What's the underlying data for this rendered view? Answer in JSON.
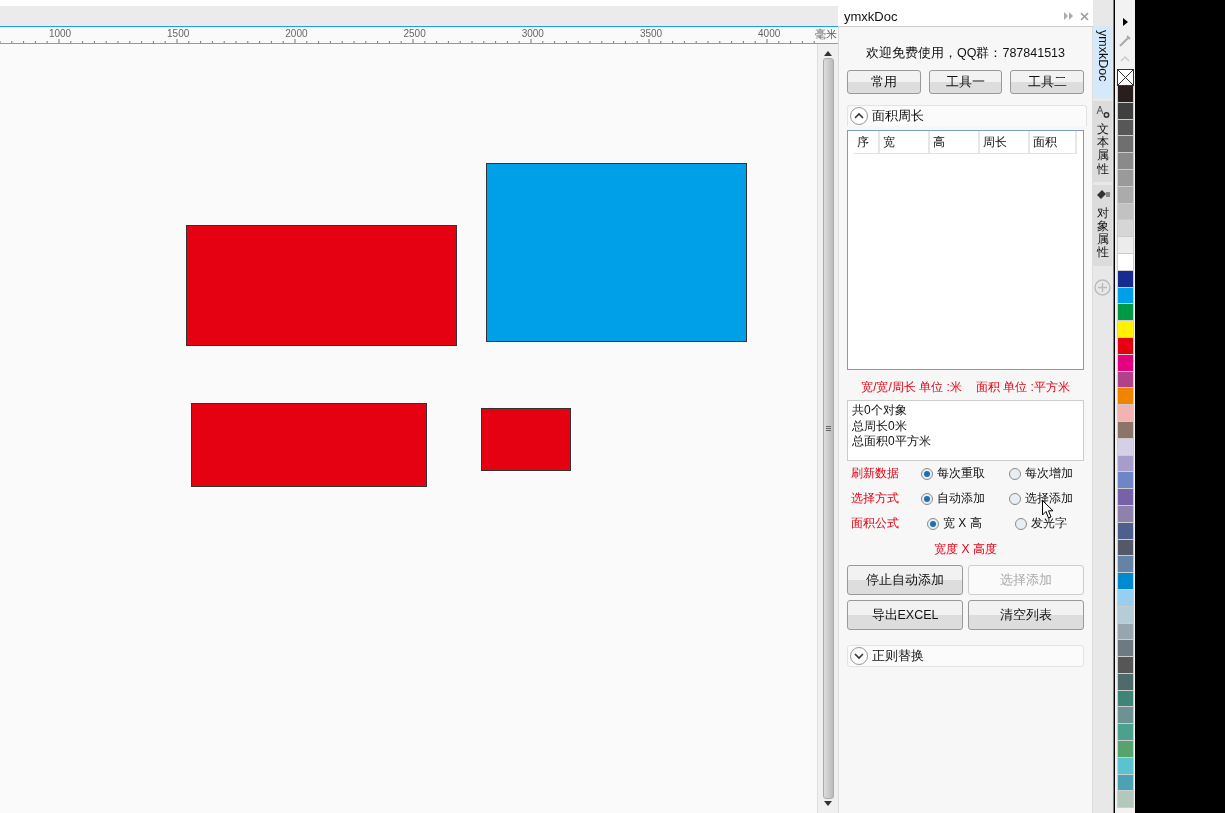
{
  "ruler": {
    "labels": [
      "1000",
      "1500",
      "2000",
      "2500",
      "3000",
      "3500",
      "4000"
    ],
    "unit": "毫米"
  },
  "canvas": {
    "shapes": [
      {
        "kind": "rect",
        "color": "#e50012"
      },
      {
        "kind": "rect",
        "color": "#00a0e9"
      },
      {
        "kind": "rect",
        "color": "#e50012"
      },
      {
        "kind": "rect",
        "color": "#e50012"
      }
    ]
  },
  "panel": {
    "title": "ymxkDoc",
    "welcome": "欢迎免费使用，QQ群：787841513",
    "tabs": [
      {
        "label": "常用",
        "selected": false
      },
      {
        "label": "工具一",
        "selected": false
      },
      {
        "label": "工具二",
        "selected": false
      }
    ],
    "sections": [
      {
        "title": "面积周长",
        "expanded": true
      },
      {
        "title": "正则替换",
        "expanded": false
      }
    ],
    "table": {
      "columns": [
        "序",
        "宽",
        "高",
        "周长",
        "面积"
      ]
    },
    "units": [
      "宽/宽/周长 单位 :米",
      "面积 单位 :平方米"
    ],
    "summary": [
      "共0个对象",
      "总周长0米",
      "总面积0平方米"
    ],
    "options": [
      {
        "label": "刷新数据",
        "choices": [
          {
            "label": "每次重取",
            "selected": true
          },
          {
            "label": "每次增加",
            "selected": false
          }
        ]
      },
      {
        "label": "选择方式",
        "choices": [
          {
            "label": "自动添加",
            "selected": true
          },
          {
            "label": "选择添加",
            "selected": false
          }
        ]
      },
      {
        "label": "面积公式",
        "choices": [
          {
            "label": "宽 X 高",
            "selected": true
          },
          {
            "label": "发光字",
            "selected": false
          }
        ]
      }
    ],
    "formula": "宽度 X 高度",
    "buttons": [
      {
        "label": "停止自动添加",
        "disabled": false
      },
      {
        "label": "选择添加",
        "disabled": true
      },
      {
        "label": "导出EXCEL",
        "disabled": false
      },
      {
        "label": "清空列表",
        "disabled": false
      }
    ]
  },
  "side_tabs": [
    {
      "label": "ymxkDoc",
      "kind": "latin",
      "selected": true
    },
    {
      "label": "文本属性",
      "kind": "cjk",
      "selected": false
    },
    {
      "label": "对象属性",
      "kind": "cjk",
      "selected": false
    }
  ],
  "palette": [
    {
      "kind": "none"
    },
    {
      "color": "#2a1e1c"
    },
    {
      "color": "#3f3f3f"
    },
    {
      "color": "#575757"
    },
    {
      "color": "#6f6f6f"
    },
    {
      "color": "#8a8a8a"
    },
    {
      "color": "#9a9a9a"
    },
    {
      "color": "#ababab"
    },
    {
      "color": "#c2c2c2"
    },
    {
      "color": "#d6d6d6"
    },
    {
      "color": "#ececec"
    },
    {
      "color": "#ffffff"
    },
    {
      "color": "#152b8f"
    },
    {
      "color": "#00a0e9"
    },
    {
      "color": "#009944"
    },
    {
      "color": "#fff100"
    },
    {
      "color": "#e60012"
    },
    {
      "color": "#e4007f"
    },
    {
      "color": "#b2418a"
    },
    {
      "color": "#f08300"
    },
    {
      "color": "#f4b3b3"
    },
    {
      "color": "#8b756b"
    },
    {
      "color": "#d5d0e8"
    },
    {
      "color": "#a79dcb"
    },
    {
      "color": "#6d87c6"
    },
    {
      "color": "#7762a8"
    },
    {
      "color": "#8e82ad"
    },
    {
      "color": "#4e5f8e"
    },
    {
      "color": "#555868"
    },
    {
      "color": "#6683a5"
    },
    {
      "color": "#0088d0"
    },
    {
      "color": "#98cfee"
    },
    {
      "color": "#b5cdd6"
    },
    {
      "color": "#97a5ae"
    },
    {
      "color": "#6c7a82"
    },
    {
      "color": "#565656"
    },
    {
      "color": "#4e6b6b"
    },
    {
      "color": "#3e8577"
    },
    {
      "color": "#6d9293"
    },
    {
      "color": "#4ba18b"
    },
    {
      "color": "#58a26c"
    },
    {
      "color": "#5bc2cf"
    },
    {
      "color": "#4aa2b4"
    },
    {
      "color": "#b4c7bb"
    }
  ]
}
